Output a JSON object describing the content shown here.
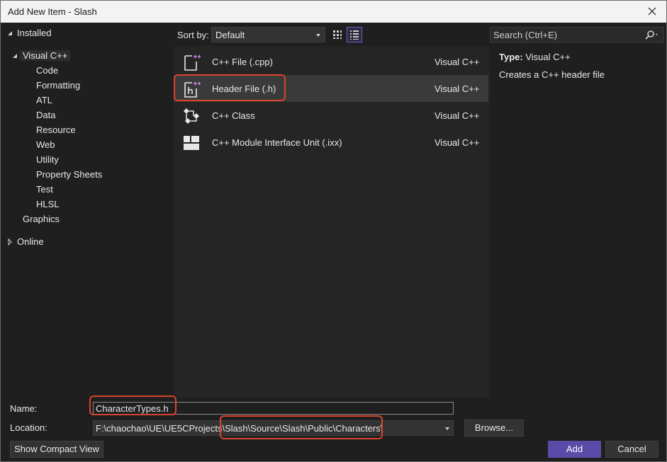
{
  "window": {
    "title": "Add New Item - Slash"
  },
  "tree": {
    "installed": "Installed",
    "visual_cpp": "Visual C++",
    "children": [
      "Code",
      "Formatting",
      "ATL",
      "Data",
      "Resource",
      "Web",
      "Utility",
      "Property Sheets",
      "Test",
      "HLSL"
    ],
    "graphics": "Graphics",
    "online": "Online"
  },
  "toolbar": {
    "sort_label": "Sort by:",
    "sort_value": "Default"
  },
  "items": [
    {
      "name": "C++ File (.cpp)",
      "lang": "Visual C++",
      "icon": "cpp-file-icon"
    },
    {
      "name": "Header File (.h)",
      "lang": "Visual C++",
      "icon": "header-file-icon",
      "selected": true
    },
    {
      "name": "C++ Class",
      "lang": "Visual C++",
      "icon": "cpp-class-icon"
    },
    {
      "name": "C++ Module Interface Unit (.ixx)",
      "lang": "Visual C++",
      "icon": "module-unit-icon"
    }
  ],
  "search": {
    "placeholder": "Search (Ctrl+E)"
  },
  "details": {
    "type_label": "Type:",
    "type_value": "Visual C++",
    "description": "Creates a C++ header file"
  },
  "form": {
    "name_label": "Name:",
    "name_value": "CharacterTypes.h",
    "location_label": "Location:",
    "location_value": "F:\\chaochao\\UE\\UE5CProjects\\Slash\\Source\\Slash\\Public\\Characters\\",
    "browse_label": "Browse...",
    "compact_label": "Show Compact View",
    "add_label": "Add",
    "cancel_label": "Cancel"
  },
  "colors": {
    "accent": "#5b4aa8",
    "highlight": "#d8432c",
    "icon_plus": "#c77ee0"
  }
}
